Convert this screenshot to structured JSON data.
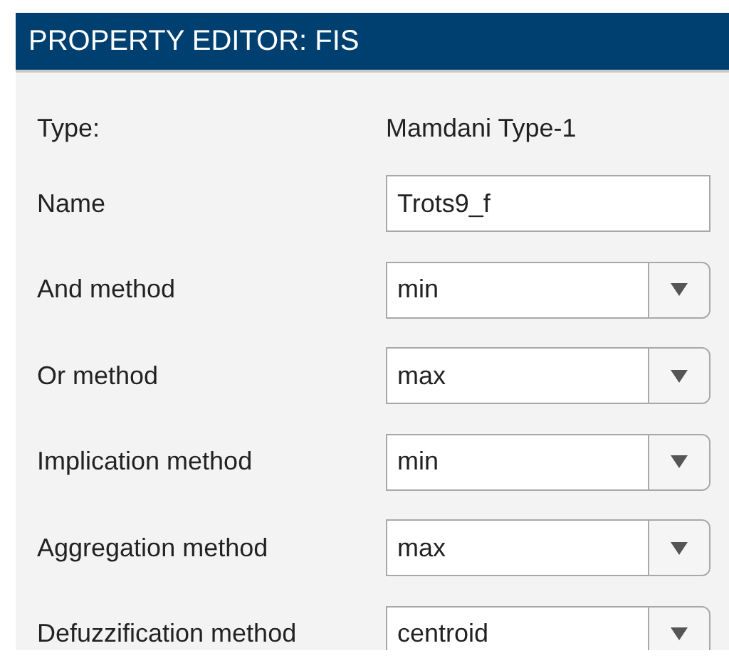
{
  "panel": {
    "title": "PROPERTY EDITOR: FIS"
  },
  "properties": [
    {
      "kind": "text",
      "label": "Type:",
      "value": "Mamdani Type-1"
    },
    {
      "kind": "input",
      "label": "Name",
      "value": "Trots9_f"
    },
    {
      "kind": "dropdown",
      "label": "And method",
      "value": "min"
    },
    {
      "kind": "dropdown",
      "label": "Or method",
      "value": "max"
    },
    {
      "kind": "dropdown",
      "label": "Implication method",
      "value": "min"
    },
    {
      "kind": "dropdown",
      "label": "Aggregation method",
      "value": "max"
    },
    {
      "kind": "dropdown",
      "label": "Defuzzification method",
      "value": "centroid"
    }
  ]
}
